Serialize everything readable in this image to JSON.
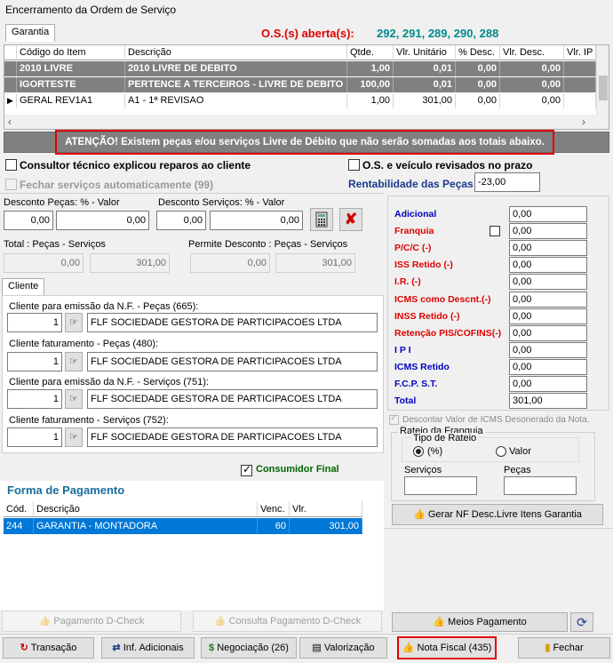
{
  "window": {
    "title": "Encerramento da Ordem de Serviço"
  },
  "tabs": {
    "garantia": "Garantia",
    "cliente": "Cliente"
  },
  "os": {
    "label": "O.S.(s) aberta(s):",
    "numbers": "292, 291, 289, 290, 288"
  },
  "items": {
    "headers": [
      "Código do Item",
      "Descrição",
      "Qtde.",
      "Vlr. Unitário",
      "% Desc.",
      "Vlr. Desc.",
      "Vlr. IP"
    ],
    "rows": [
      [
        "2010 LIVRE",
        "2010 LIVRE DE DEBITO",
        "1,00",
        "0,01",
        "0,00",
        "0,00",
        ""
      ],
      [
        "IGORTESTE",
        "PERTENCE A TERCEIROS - LIVRE DE DEBITO",
        "100,00",
        "0,01",
        "0,00",
        "0,00",
        ""
      ],
      [
        "GERAL REV1A1",
        "A1 - 1ª REVISAO",
        "1,00",
        "301,00",
        "0,00",
        "0,00",
        ""
      ]
    ]
  },
  "warning": "ATENÇÃO! Existem peças e/ou serviços Livre de Débito que não serão somadas aos totais abaixo.",
  "checks": {
    "consultor": "Consultor técnico explicou reparos ao cliente",
    "fechar": "Fechar serviços automaticamente (99)",
    "os_revisados": "O.S. e veículo revisados no prazo"
  },
  "rentabilidade": {
    "label": "Rentabilidade das Peças",
    "value": "-23,00"
  },
  "desconto": {
    "pecas_label": "Desconto Peças: % - Valor",
    "pecas_pct": "0,00",
    "pecas_val": "0,00",
    "serv_label": "Desconto Serviços: % - Valor",
    "serv_pct": "0,00",
    "serv_val": "0,00"
  },
  "totais": {
    "label": "Total : Peças - Serviços",
    "pecas": "0,00",
    "servicos": "301,00",
    "permite_label": "Permite Desconto : Peças - Serviços",
    "permite_pecas": "0,00",
    "permite_servicos": "301,00"
  },
  "clientes": [
    {
      "label": "Cliente para emissão da N.F. - Peças (665):",
      "code": "1",
      "name": "FLF SOCIEDADE GESTORA DE PARTICIPACOES LTDA"
    },
    {
      "label": "Cliente faturamento - Peças (480):",
      "code": "1",
      "name": "FLF SOCIEDADE GESTORA DE PARTICIPACOES LTDA"
    },
    {
      "label": "Cliente para emissão da N.F. - Serviços (751):",
      "code": "1",
      "name": "FLF SOCIEDADE GESTORA DE PARTICIPACOES LTDA"
    },
    {
      "label": "Cliente faturamento - Serviços (752):",
      "code": "1",
      "name": "FLF SOCIEDADE GESTORA DE PARTICIPACOES LTDA"
    }
  ],
  "consumidor_final": "Consumidor Final",
  "pagamento": {
    "title": "Forma de Pagamento",
    "headers": [
      "Cód.",
      "Descrição",
      "Venc.",
      "Vlr. Pagamento"
    ],
    "rows": [
      [
        "244",
        "GARANTIA - MONTADORA",
        "60",
        "301,00"
      ]
    ]
  },
  "impostos": [
    {
      "label": "Adicional",
      "value": "0,00",
      "color": "#0000c0"
    },
    {
      "label": "Franquia",
      "value": "0,00",
      "color": "#e00000"
    },
    {
      "label": "P/C/C (-)",
      "value": "0,00",
      "color": "#e00000"
    },
    {
      "label": "ISS Retido (-)",
      "value": "0,00",
      "color": "#e00000"
    },
    {
      "label": "I.R. (-)",
      "value": "0,00",
      "color": "#e00000"
    },
    {
      "label": "ICMS como Descnt.(-)",
      "value": "0,00",
      "color": "#e00000"
    },
    {
      "label": "INSS Retido (-)",
      "value": "0,00",
      "color": "#e00000"
    },
    {
      "label": "Retenção PIS/COFINS(-)",
      "value": "0,00",
      "color": "#e00000"
    },
    {
      "label": "I P I",
      "value": "0,00",
      "color": "#0000c0"
    },
    {
      "label": "ICMS Retido",
      "value": "0,00",
      "color": "#0000c0"
    },
    {
      "label": "F.C.P.  S.T.",
      "value": "0,00",
      "color": "#0000c0"
    },
    {
      "label": "Total",
      "value": "301,00",
      "color": "#0000c0"
    }
  ],
  "icms_deson": "Descontar Valor de ICMS Desonerado da Nota.",
  "rateio": {
    "title": "Rateio da Franquia",
    "tipo": "Tipo de Rateio",
    "pct": "(%)",
    "valor": "Valor",
    "servicos": "Serviços",
    "pecas": "Peças"
  },
  "buttons": {
    "gerar_nf": "Gerar NF Desc.Livre Itens Garantia",
    "pag_dcheck": "Pagamento D-Check",
    "consulta_dcheck": "Consulta Pagamento D-Check",
    "meios": "Meios Pagamento",
    "transacao": "Transação",
    "inf_adic": "Inf. Adicionais",
    "negociacao": "Negociação (26)",
    "valorizacao": "Valorização",
    "nota_fiscal": "Nota Fiscal (435)",
    "fechar": "Fechar"
  }
}
